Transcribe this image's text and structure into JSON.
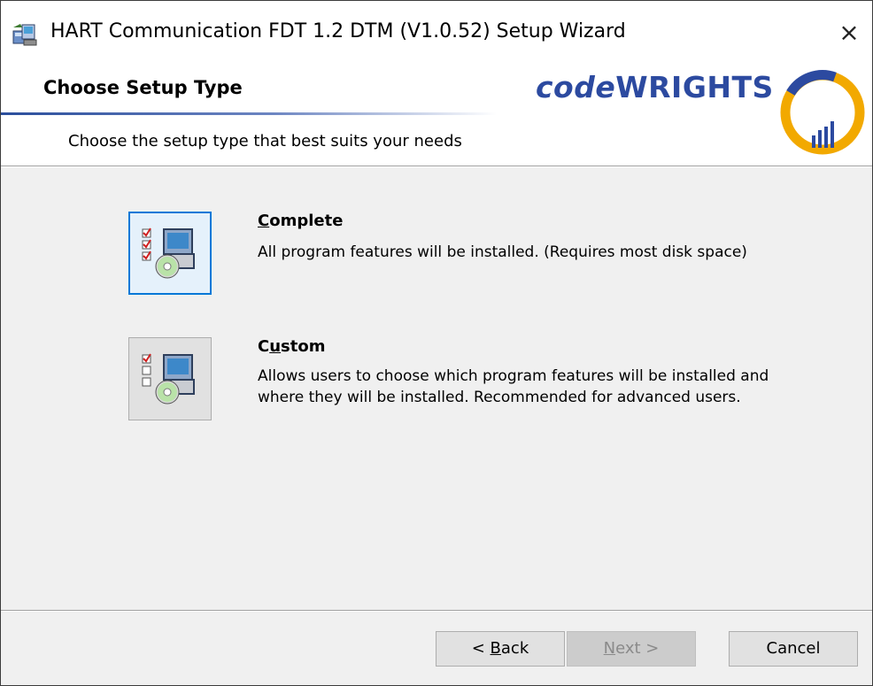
{
  "window": {
    "title": "HART Communication FDT 1.2 DTM (V1.0.52) Setup Wizard",
    "close_label": "×"
  },
  "banner": {
    "title": "Choose Setup Type",
    "subtitle": "Choose the setup type that best suits your needs",
    "brand_code": "code",
    "brand_wrights": "WRIGHTS",
    "logo_text_top": "code",
    "logo_text_bottom": "WRIGHTS"
  },
  "options": [
    {
      "title_access": "C",
      "title_rest": "omplete",
      "description": "All program features will be installed.  (Requires most disk space)"
    },
    {
      "title_pre": "C",
      "title_access": "u",
      "title_rest": "stom",
      "description": "Allows users to choose which program features will be installed and where they will be installed. Recommended for advanced users."
    }
  ],
  "buttons": {
    "back_pre": "< ",
    "back_access": "B",
    "back_rest": "ack",
    "next_access": "N",
    "next_rest": "ext >",
    "cancel": "Cancel"
  },
  "colors": {
    "accent": "#0078d7",
    "brand": "#2c4aa0",
    "logo_ring": "#f2a900"
  }
}
